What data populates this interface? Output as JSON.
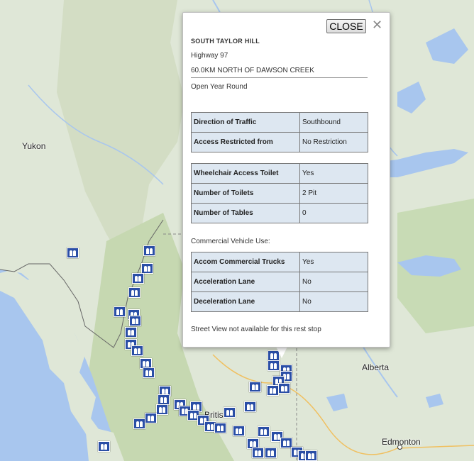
{
  "map": {
    "labels": {
      "yukon": "Yukon",
      "alberta": "Alberta",
      "edmonton": "Edmonton",
      "british": "Britis"
    },
    "colors": {
      "land": "#dfe7d7",
      "water": "#a8c6ee",
      "mountain": "#c4d6b0"
    },
    "marker_icon": "restroom-icon"
  },
  "popup": {
    "close_label": "CLOSE",
    "close_x": "✕",
    "title": "SOUTH TAYLOR HILL",
    "highway": "Highway 97",
    "location": "60.0KM NORTH OF DAWSON CREEK",
    "season": "Open Year Round",
    "table1": [
      {
        "label": "Direction of Traffic",
        "value": "Southbound"
      },
      {
        "label": "Access Restricted from",
        "value": "No Restriction"
      }
    ],
    "table2": [
      {
        "label": "Wheelchair Access Toilet",
        "value": "Yes"
      },
      {
        "label": "Number of Toilets",
        "value": "2 Pit"
      },
      {
        "label": "Number of Tables",
        "value": "0"
      }
    ],
    "commercial_heading": "Commercial Vehicle Use:",
    "table3": [
      {
        "label": "Accom Commercial Trucks",
        "value": "Yes"
      },
      {
        "label": "Acceleration Lane",
        "value": "No"
      },
      {
        "label": "Deceleration Lane",
        "value": "No"
      }
    ],
    "street_view": "Street View not available for this rest stop"
  }
}
